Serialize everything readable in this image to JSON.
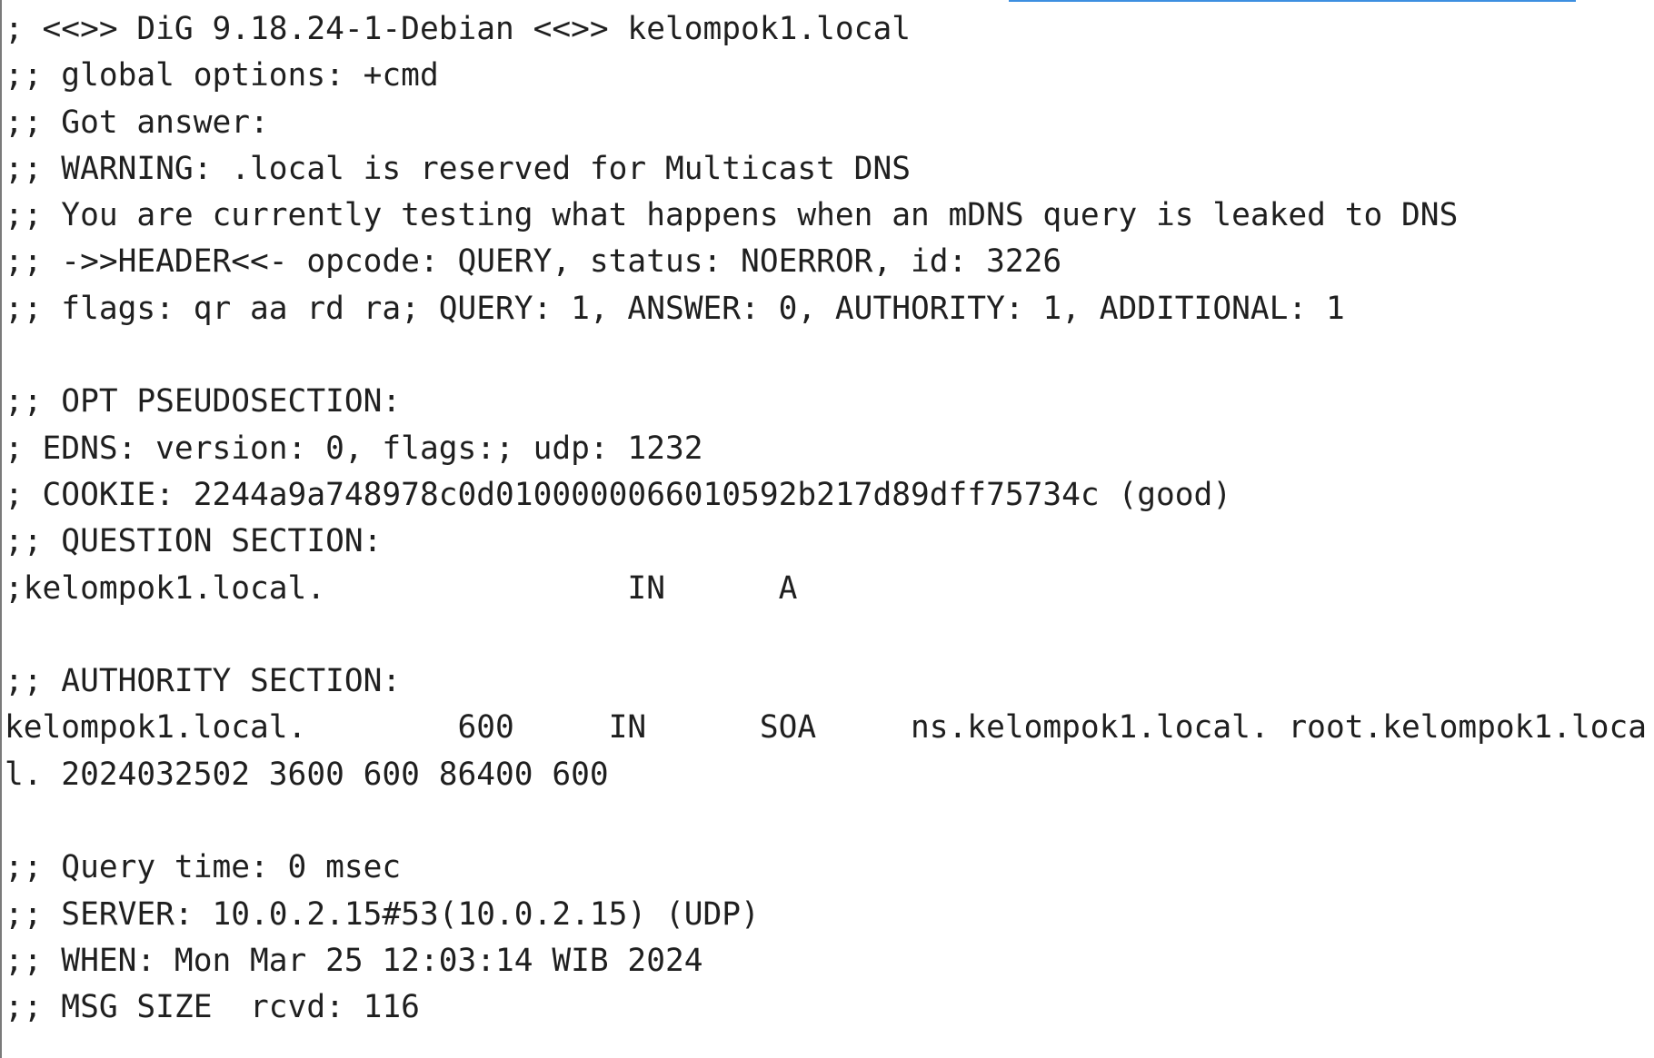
{
  "terminal": {
    "lines": [
      "; <<>> DiG 9.18.24-1-Debian <<>> kelompok1.local",
      ";; global options: +cmd",
      ";; Got answer:",
      ";; WARNING: .local is reserved for Multicast DNS",
      ";; You are currently testing what happens when an mDNS query is leaked to DNS",
      ";; ->>HEADER<<- opcode: QUERY, status: NOERROR, id: 3226",
      ";; flags: qr aa rd ra; QUERY: 1, ANSWER: 0, AUTHORITY: 1, ADDITIONAL: 1",
      "",
      ";; OPT PSEUDOSECTION:",
      "; EDNS: version: 0, flags:; udp: 1232",
      "; COOKIE: 2244a9a748978c0d0100000066010592b217d89dff75734c (good)",
      ";; QUESTION SECTION:",
      ";kelompok1.local.                IN      A",
      "",
      ";; AUTHORITY SECTION:",
      "kelompok1.local.        600     IN      SOA     ns.kelompok1.local. root.kelompok1.loca",
      "l. 2024032502 3600 600 86400 600",
      "",
      ";; Query time: 0 msec",
      ";; SERVER: 10.0.2.15#53(10.0.2.15) (UDP)",
      ";; WHEN: Mon Mar 25 12:03:14 WIB 2024",
      ";; MSG SIZE  rcvd: 116"
    ]
  }
}
